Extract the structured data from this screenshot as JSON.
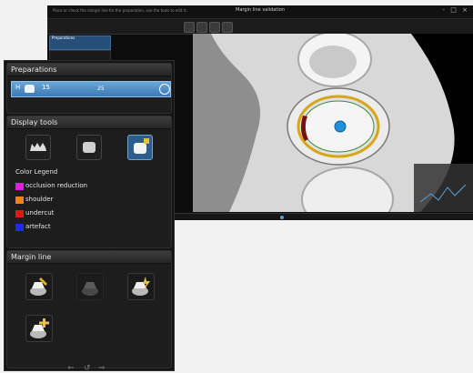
{
  "window": {
    "title": "Margin line validation",
    "subtitle": "Place or check the margin line for the preparation, use the tools to edit it.",
    "controls": "- □ ×"
  },
  "panel": {
    "preparations": {
      "header": "Preparations",
      "row": {
        "left": "H",
        "center": "15",
        "count": "25"
      },
      "mini_label": "Preparations"
    },
    "display_tools": {
      "header": "Display tools"
    },
    "color_legend": {
      "title": "Color Legend",
      "items": [
        {
          "label": "occlusion reduction",
          "color": "#e020e0"
        },
        {
          "label": "shoulder",
          "color": "#f08018"
        },
        {
          "label": "undercut",
          "color": "#e01818"
        },
        {
          "label": "artefact",
          "color": "#1f2cf0"
        }
      ]
    },
    "margin_line": {
      "header": "Margin line",
      "nav": {
        "back": "⇐",
        "reset": "↺",
        "forward": "⇒"
      }
    }
  },
  "colors": {
    "accent": "#3c78b4",
    "panel_bg": "#141414",
    "marker": "#1f8fd8"
  }
}
